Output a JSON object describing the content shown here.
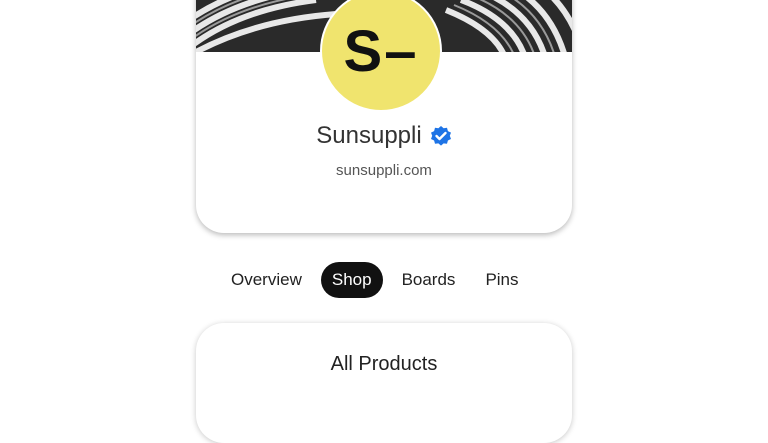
{
  "profile": {
    "avatar_text": "S–",
    "avatar_color": "#f0e46e",
    "name": "Sunsuppli",
    "verified_icon": "verified-check-icon",
    "verified_color": "#1e74e6",
    "website": "sunsuppli.com"
  },
  "tabs": [
    {
      "label": "Overview",
      "active": false
    },
    {
      "label": "Shop",
      "active": true
    },
    {
      "label": "Boards",
      "active": false
    },
    {
      "label": "Pins",
      "active": false
    }
  ],
  "products": {
    "title": "All Products"
  }
}
